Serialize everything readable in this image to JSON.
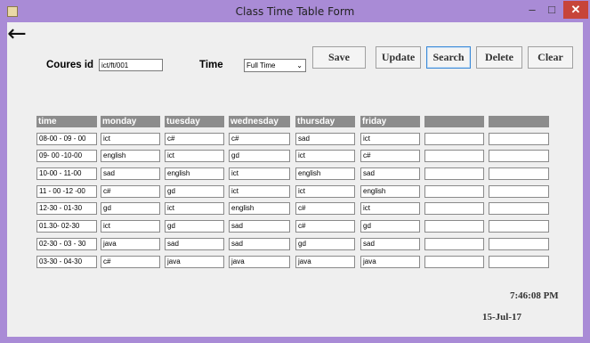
{
  "window": {
    "title": "Class Time Table Form",
    "minimize": "–",
    "maximize": "□",
    "close": "✕"
  },
  "form": {
    "back_icon": "←",
    "course_label": "Coures id",
    "course_value": "ict/ft/001",
    "time_label": "Time",
    "time_value": "Full Time",
    "dropdown_icon": "chevron-down-icon"
  },
  "buttons": {
    "save": "Save",
    "update": "Update",
    "search": "Search",
    "delete": "Delete",
    "clear": "Clear"
  },
  "table": {
    "headers": [
      "time",
      "monday",
      "tuesday",
      "wednesday",
      "thursday",
      "friday",
      "",
      ""
    ],
    "rows": [
      [
        "08-00 - 09 - 00",
        "ict",
        "c#",
        "c#",
        "sad",
        "ict",
        "",
        ""
      ],
      [
        "09- 00 -10-00",
        "english",
        "ict",
        "gd",
        "ict",
        "c#",
        "",
        ""
      ],
      [
        "10-00 - 11-00",
        "sad",
        "english",
        "ict",
        "english",
        "sad",
        "",
        ""
      ],
      [
        "11 - 00 -12 -00",
        "c#",
        "gd",
        "ict",
        "ict",
        "english",
        "",
        ""
      ],
      [
        "12-30 - 01-30",
        "gd",
        "ict",
        "english",
        "c#",
        "ict",
        "",
        ""
      ],
      [
        "01.30- 02-30",
        "ict",
        "gd",
        "sad",
        "c#",
        "gd",
        "",
        ""
      ],
      [
        "02-30 - 03 - 30",
        "java",
        "sad",
        "sad",
        "gd",
        "sad",
        "",
        ""
      ],
      [
        "03-30 - 04-30",
        "c#",
        "java",
        "java",
        "java",
        "java",
        "",
        ""
      ]
    ]
  },
  "status": {
    "time": "7:46:08 PM",
    "date": "15-Jul-17"
  }
}
